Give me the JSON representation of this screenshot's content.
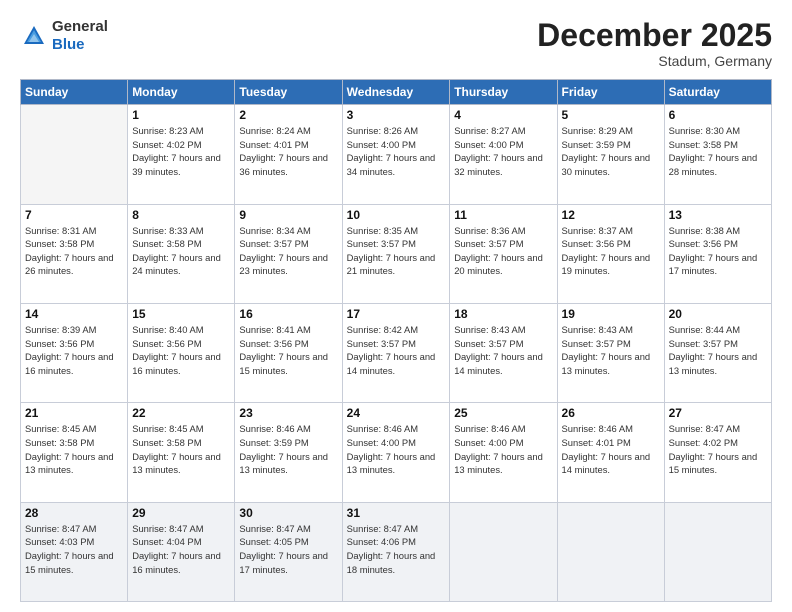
{
  "header": {
    "logo_general": "General",
    "logo_blue": "Blue",
    "title": "December 2025",
    "location": "Stadum, Germany"
  },
  "days_of_week": [
    "Sunday",
    "Monday",
    "Tuesday",
    "Wednesday",
    "Thursday",
    "Friday",
    "Saturday"
  ],
  "weeks": [
    [
      {
        "day": "",
        "sunrise": "",
        "sunset": "",
        "daylight": ""
      },
      {
        "day": "1",
        "sunrise": "Sunrise: 8:23 AM",
        "sunset": "Sunset: 4:02 PM",
        "daylight": "Daylight: 7 hours and 39 minutes."
      },
      {
        "day": "2",
        "sunrise": "Sunrise: 8:24 AM",
        "sunset": "Sunset: 4:01 PM",
        "daylight": "Daylight: 7 hours and 36 minutes."
      },
      {
        "day": "3",
        "sunrise": "Sunrise: 8:26 AM",
        "sunset": "Sunset: 4:00 PM",
        "daylight": "Daylight: 7 hours and 34 minutes."
      },
      {
        "day": "4",
        "sunrise": "Sunrise: 8:27 AM",
        "sunset": "Sunset: 4:00 PM",
        "daylight": "Daylight: 7 hours and 32 minutes."
      },
      {
        "day": "5",
        "sunrise": "Sunrise: 8:29 AM",
        "sunset": "Sunset: 3:59 PM",
        "daylight": "Daylight: 7 hours and 30 minutes."
      },
      {
        "day": "6",
        "sunrise": "Sunrise: 8:30 AM",
        "sunset": "Sunset: 3:58 PM",
        "daylight": "Daylight: 7 hours and 28 minutes."
      }
    ],
    [
      {
        "day": "7",
        "sunrise": "Sunrise: 8:31 AM",
        "sunset": "Sunset: 3:58 PM",
        "daylight": "Daylight: 7 hours and 26 minutes."
      },
      {
        "day": "8",
        "sunrise": "Sunrise: 8:33 AM",
        "sunset": "Sunset: 3:58 PM",
        "daylight": "Daylight: 7 hours and 24 minutes."
      },
      {
        "day": "9",
        "sunrise": "Sunrise: 8:34 AM",
        "sunset": "Sunset: 3:57 PM",
        "daylight": "Daylight: 7 hours and 23 minutes."
      },
      {
        "day": "10",
        "sunrise": "Sunrise: 8:35 AM",
        "sunset": "Sunset: 3:57 PM",
        "daylight": "Daylight: 7 hours and 21 minutes."
      },
      {
        "day": "11",
        "sunrise": "Sunrise: 8:36 AM",
        "sunset": "Sunset: 3:57 PM",
        "daylight": "Daylight: 7 hours and 20 minutes."
      },
      {
        "day": "12",
        "sunrise": "Sunrise: 8:37 AM",
        "sunset": "Sunset: 3:56 PM",
        "daylight": "Daylight: 7 hours and 19 minutes."
      },
      {
        "day": "13",
        "sunrise": "Sunrise: 8:38 AM",
        "sunset": "Sunset: 3:56 PM",
        "daylight": "Daylight: 7 hours and 17 minutes."
      }
    ],
    [
      {
        "day": "14",
        "sunrise": "Sunrise: 8:39 AM",
        "sunset": "Sunset: 3:56 PM",
        "daylight": "Daylight: 7 hours and 16 minutes."
      },
      {
        "day": "15",
        "sunrise": "Sunrise: 8:40 AM",
        "sunset": "Sunset: 3:56 PM",
        "daylight": "Daylight: 7 hours and 16 minutes."
      },
      {
        "day": "16",
        "sunrise": "Sunrise: 8:41 AM",
        "sunset": "Sunset: 3:56 PM",
        "daylight": "Daylight: 7 hours and 15 minutes."
      },
      {
        "day": "17",
        "sunrise": "Sunrise: 8:42 AM",
        "sunset": "Sunset: 3:57 PM",
        "daylight": "Daylight: 7 hours and 14 minutes."
      },
      {
        "day": "18",
        "sunrise": "Sunrise: 8:43 AM",
        "sunset": "Sunset: 3:57 PM",
        "daylight": "Daylight: 7 hours and 14 minutes."
      },
      {
        "day": "19",
        "sunrise": "Sunrise: 8:43 AM",
        "sunset": "Sunset: 3:57 PM",
        "daylight": "Daylight: 7 hours and 13 minutes."
      },
      {
        "day": "20",
        "sunrise": "Sunrise: 8:44 AM",
        "sunset": "Sunset: 3:57 PM",
        "daylight": "Daylight: 7 hours and 13 minutes."
      }
    ],
    [
      {
        "day": "21",
        "sunrise": "Sunrise: 8:45 AM",
        "sunset": "Sunset: 3:58 PM",
        "daylight": "Daylight: 7 hours and 13 minutes."
      },
      {
        "day": "22",
        "sunrise": "Sunrise: 8:45 AM",
        "sunset": "Sunset: 3:58 PM",
        "daylight": "Daylight: 7 hours and 13 minutes."
      },
      {
        "day": "23",
        "sunrise": "Sunrise: 8:46 AM",
        "sunset": "Sunset: 3:59 PM",
        "daylight": "Daylight: 7 hours and 13 minutes."
      },
      {
        "day": "24",
        "sunrise": "Sunrise: 8:46 AM",
        "sunset": "Sunset: 4:00 PM",
        "daylight": "Daylight: 7 hours and 13 minutes."
      },
      {
        "day": "25",
        "sunrise": "Sunrise: 8:46 AM",
        "sunset": "Sunset: 4:00 PM",
        "daylight": "Daylight: 7 hours and 13 minutes."
      },
      {
        "day": "26",
        "sunrise": "Sunrise: 8:46 AM",
        "sunset": "Sunset: 4:01 PM",
        "daylight": "Daylight: 7 hours and 14 minutes."
      },
      {
        "day": "27",
        "sunrise": "Sunrise: 8:47 AM",
        "sunset": "Sunset: 4:02 PM",
        "daylight": "Daylight: 7 hours and 15 minutes."
      }
    ],
    [
      {
        "day": "28",
        "sunrise": "Sunrise: 8:47 AM",
        "sunset": "Sunset: 4:03 PM",
        "daylight": "Daylight: 7 hours and 15 minutes."
      },
      {
        "day": "29",
        "sunrise": "Sunrise: 8:47 AM",
        "sunset": "Sunset: 4:04 PM",
        "daylight": "Daylight: 7 hours and 16 minutes."
      },
      {
        "day": "30",
        "sunrise": "Sunrise: 8:47 AM",
        "sunset": "Sunset: 4:05 PM",
        "daylight": "Daylight: 7 hours and 17 minutes."
      },
      {
        "day": "31",
        "sunrise": "Sunrise: 8:47 AM",
        "sunset": "Sunset: 4:06 PM",
        "daylight": "Daylight: 7 hours and 18 minutes."
      },
      {
        "day": "",
        "sunrise": "",
        "sunset": "",
        "daylight": ""
      },
      {
        "day": "",
        "sunrise": "",
        "sunset": "",
        "daylight": ""
      },
      {
        "day": "",
        "sunrise": "",
        "sunset": "",
        "daylight": ""
      }
    ]
  ]
}
